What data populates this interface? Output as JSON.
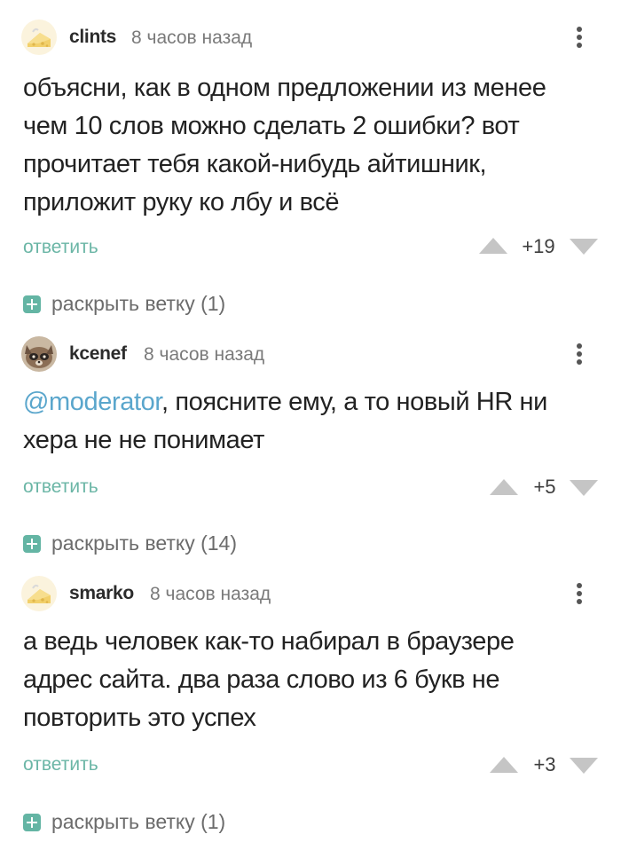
{
  "comments": [
    {
      "username": "clints",
      "time": "8 часов назад",
      "text_lines": [
        "объясни, как в одном предложении из менее",
        "чем 10 слов можно сделать 2 ошибки? вот",
        "прочитает тебя какой-нибудь айтишник,",
        "приложит руку ко лбу и всё"
      ],
      "reply_label": "ответить",
      "score": "+19",
      "expand_label": "раскрыть ветку (1)"
    },
    {
      "username": "kcenef",
      "time": "8 часов назад",
      "mention": "@moderator",
      "text_after_mention": ", поясните ему, а то новый HR ни",
      "text_line_2": "хера не не понимает",
      "reply_label": "ответить",
      "score": "+5",
      "expand_label": "раскрыть ветку (14)"
    },
    {
      "username": "smarko",
      "time": "8 часов назад",
      "text_lines": [
        "а ведь человек как-то набирал в браузере",
        "адрес сайта. два раза слово из 6 букв не",
        "повторить это успех"
      ],
      "reply_label": "ответить",
      "score": "+3",
      "expand_label": "раскрыть ветку (1)"
    }
  ],
  "icons": {
    "avatar_default": "cheese-avatar-icon",
    "avatar_kcenef": "raccoon-avatar-icon",
    "menu": "kebab-menu-icon",
    "upvote": "triangle-up-icon",
    "downvote": "triangle-down-icon",
    "expand": "plus-box-icon"
  },
  "colors": {
    "reply": "#6bb6a6",
    "mention": "#5aa6cc",
    "vote_arrow": "#c5c5c5",
    "expand_box": "#64b5a4"
  }
}
